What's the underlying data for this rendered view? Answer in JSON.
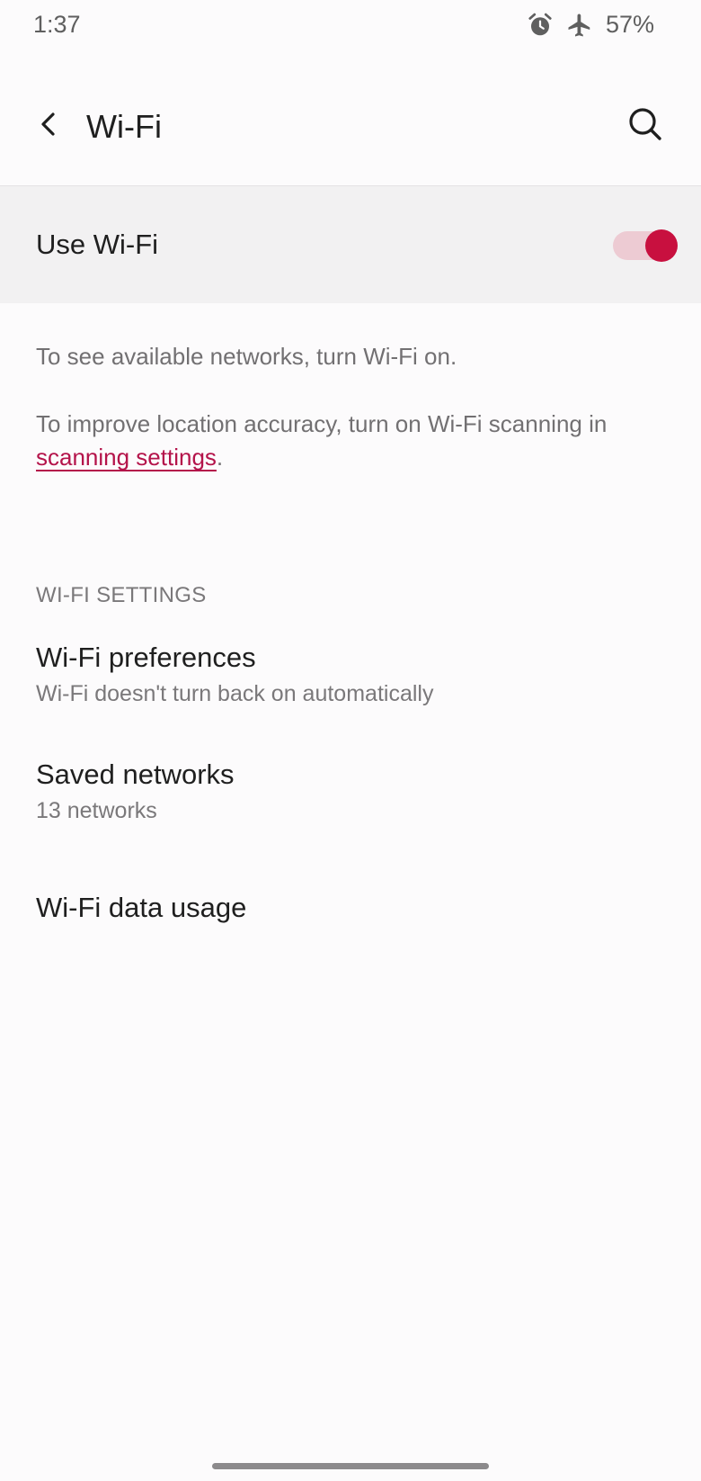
{
  "status_bar": {
    "time": "1:37",
    "battery": "57%",
    "icons": [
      "alarm-icon",
      "airplane-mode-icon"
    ]
  },
  "app_bar": {
    "title": "Wi-Fi",
    "icons": [
      "back-arrow-icon",
      "search-icon"
    ]
  },
  "master_switch": {
    "label": "Use Wi-Fi",
    "enabled": true
  },
  "info": {
    "line1": "To see available networks, turn Wi-Fi on.",
    "line2_prefix": "To improve location accuracy, turn on Wi-Fi scanning in ",
    "line2_link": "scanning settings",
    "line2_suffix": "."
  },
  "settings_section": {
    "header": "WI-FI SETTINGS",
    "items": [
      {
        "title": "Wi-Fi preferences",
        "summary": "Wi-Fi doesn't turn back on automatically"
      },
      {
        "title": "Saved networks",
        "summary": "13 networks"
      },
      {
        "title": "Wi-Fi data usage"
      }
    ]
  },
  "colors": {
    "accent": "#c8103f",
    "link": "#b4134a",
    "track": "#edcbd3",
    "background": "#fcfbfc"
  }
}
